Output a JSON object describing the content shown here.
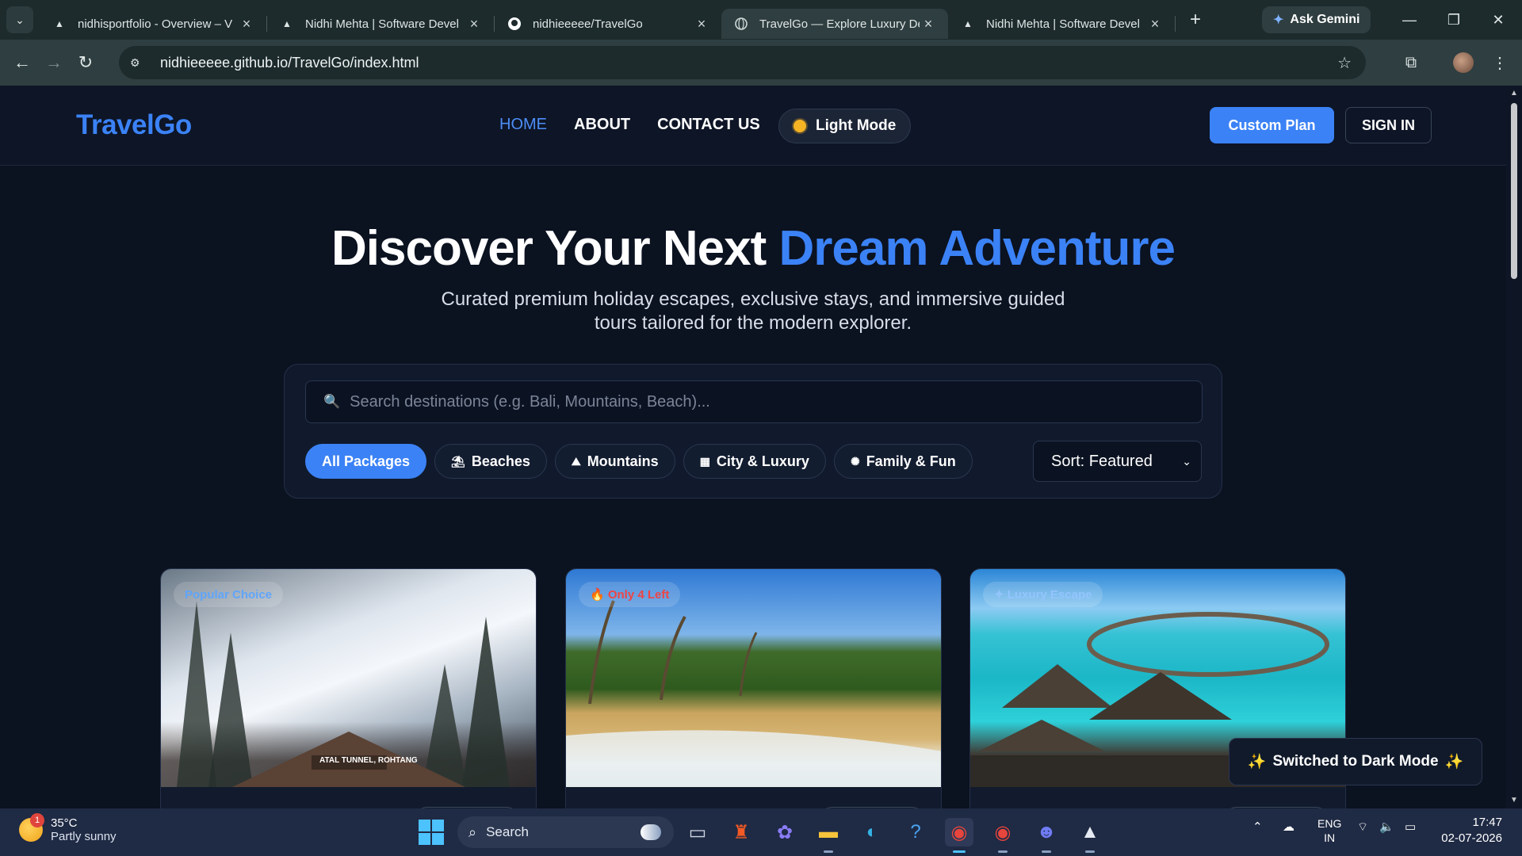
{
  "browser": {
    "tabs": [
      {
        "title": "nidhisportfolio - Overview – V",
        "favicon": "vercel-icon",
        "active": false
      },
      {
        "title": "Nidhi Mehta | Software Devel",
        "favicon": "vercel-icon",
        "active": false
      },
      {
        "title": "nidhieeeee/TravelGo",
        "favicon": "github-icon",
        "active": false
      },
      {
        "title": "TravelGo — Explore Luxury De",
        "favicon": "globe-icon",
        "active": true
      },
      {
        "title": "Nidhi Mehta | Software Devel",
        "favicon": "vercel-icon",
        "active": false
      }
    ],
    "ask_gemini": "Ask Gemini",
    "url": "nidhieeeee.github.io/TravelGo/index.html"
  },
  "site": {
    "logo": "TravelGo",
    "nav": [
      "HOME",
      "ABOUT",
      "CONTACT US"
    ],
    "theme_toggle": "Light Mode",
    "custom_plan": "Custom Plan",
    "sign_in": "SIGN IN"
  },
  "hero": {
    "title_part1": "Discover Your Next ",
    "title_accent": "Dream Adventure",
    "subtitle_line1": "Curated premium holiday escapes, exclusive stays, and immersive guided",
    "subtitle_line2": "tours tailored for the modern explorer."
  },
  "search": {
    "placeholder": "Search destinations (e.g. Bali, Mountains, Beach)...",
    "value": "",
    "filters": [
      {
        "label": "All Packages",
        "icon": "",
        "active": true
      },
      {
        "label": "Beaches",
        "icon": "beach-umbrella-icon",
        "active": false
      },
      {
        "label": "Mountains",
        "icon": "mountain-icon",
        "active": false
      },
      {
        "label": "City & Luxury",
        "icon": "cityscape-icon",
        "active": false
      },
      {
        "label": "Family & Fun",
        "icon": "ferris-wheel-icon",
        "active": false
      }
    ],
    "sort": "Sort: Featured"
  },
  "cards": [
    {
      "badge": "Popular Choice",
      "badge_color": "#60a5fa",
      "image": "snowy-mountain-tunnel",
      "sign_text": "ATAL TUNNEL, ROHTANG"
    },
    {
      "badge": "🔥 Only 4 Left",
      "badge_color": "#ef4444",
      "image": "tropical-beach"
    },
    {
      "badge": "✦ Luxury Escape",
      "badge_color": "#93c5fd",
      "image": "overwater-villas"
    }
  ],
  "toast": {
    "text": "Switched to Dark Mode"
  },
  "taskbar": {
    "temp": "35°C",
    "weather": "Partly sunny",
    "weather_badge": "1",
    "search": "Search",
    "lang1": "ENG",
    "lang2": "IN",
    "time": "17:47",
    "date": "02-07-2026"
  },
  "colors": {
    "accent": "#3b82f6",
    "page_bg": "#0b1220",
    "header_bg": "#0d1526"
  }
}
